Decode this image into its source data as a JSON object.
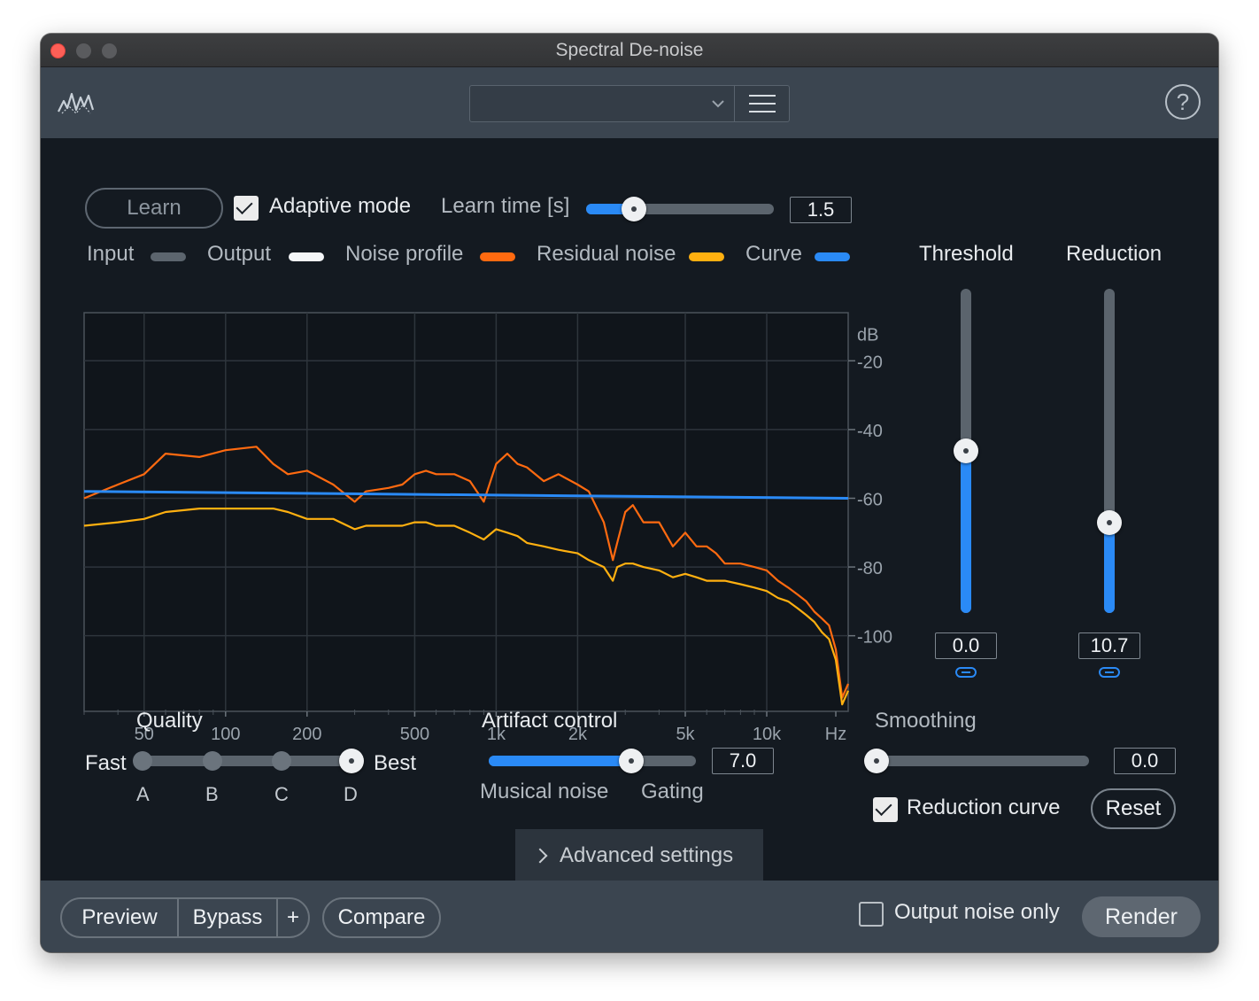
{
  "window": {
    "title": "Spectral De-noise"
  },
  "toolbar": {
    "preset_value": "",
    "help_label": "?"
  },
  "learn": {
    "button_label": "Learn",
    "adaptive_mode_label": "Adaptive mode",
    "adaptive_mode_checked": true,
    "learn_time_label": "Learn time [s]",
    "learn_time_value": "1.5",
    "learn_time_fraction": 0.24
  },
  "legend": {
    "items": [
      {
        "label": "Input",
        "color": "#5c656e"
      },
      {
        "label": "Output",
        "color": "#f4f6f8"
      },
      {
        "label": "Noise profile",
        "color": "#ff6a10"
      },
      {
        "label": "Residual noise",
        "color": "#ffb010"
      },
      {
        "label": "Curve",
        "color": "#2a8af6"
      }
    ]
  },
  "chart_data": {
    "type": "line",
    "x_scale": "log",
    "y_unit": "dB",
    "x_unit": "Hz",
    "x_ticks": [
      "50",
      "100",
      "200",
      "500",
      "1k",
      "2k",
      "5k",
      "10k",
      "Hz"
    ],
    "y_ticks": [
      "dB",
      "-20",
      "-40",
      "-60",
      "-80",
      "-100"
    ],
    "xlim": [
      30,
      20000
    ],
    "ylim": [
      -122,
      -6
    ],
    "series": [
      {
        "name": "Noise profile",
        "color": "#ff6a10",
        "x": [
          30,
          40,
          50,
          60,
          80,
          100,
          130,
          150,
          170,
          200,
          250,
          300,
          330,
          400,
          450,
          500,
          550,
          600,
          700,
          800,
          900,
          1000,
          1100,
          1200,
          1300,
          1500,
          1700,
          2000,
          2200,
          2500,
          2700,
          2800,
          3000,
          3200,
          3500,
          4000,
          4500,
          5000,
          5500,
          6000,
          6500,
          7000,
          8000,
          9000,
          10000,
          11000,
          12000,
          13000,
          14000,
          15000,
          16000,
          17000,
          18000,
          19000,
          20000
        ],
        "y": [
          -60,
          -56,
          -53,
          -47,
          -48,
          -46,
          -45,
          -50,
          -53,
          -52,
          -56,
          -61,
          -58,
          -57,
          -56,
          -53,
          -52,
          -53,
          -53,
          -55,
          -61,
          -50,
          -47,
          -50,
          -51,
          -55,
          -53,
          -56,
          -58,
          -67,
          -78,
          -73,
          -64,
          -62,
          -67,
          -67,
          -74,
          -70,
          -74,
          -74,
          -76,
          -79,
          -79,
          -80,
          -81,
          -84,
          -86,
          -88,
          -90,
          -93,
          -95,
          -97,
          -104,
          -118,
          -114
        ]
      },
      {
        "name": "Residual noise",
        "color": "#ffb010",
        "x": [
          30,
          40,
          50,
          60,
          80,
          100,
          130,
          150,
          170,
          200,
          250,
          300,
          330,
          400,
          450,
          500,
          550,
          600,
          700,
          800,
          900,
          1000,
          1100,
          1200,
          1300,
          1500,
          1700,
          2000,
          2200,
          2500,
          2700,
          2800,
          3000,
          3200,
          3500,
          4000,
          4500,
          5000,
          5500,
          6000,
          6500,
          7000,
          8000,
          9000,
          10000,
          11000,
          12000,
          13000,
          14000,
          15000,
          16000,
          17000,
          18000,
          19000,
          20000
        ],
        "y": [
          -68,
          -67,
          -66,
          -64,
          -63,
          -63,
          -63,
          -63,
          -64,
          -66,
          -66,
          -69,
          -68,
          -68,
          -68,
          -67,
          -67,
          -68,
          -68,
          -70,
          -72,
          -69,
          -70,
          -71,
          -73,
          -74,
          -75,
          -76,
          -78,
          -80,
          -84,
          -80,
          -79,
          -79,
          -80,
          -81,
          -83,
          -82,
          -83,
          -84,
          -84,
          -84,
          -85,
          -86,
          -87,
          -89,
          -90,
          -92,
          -94,
          -96,
          -99,
          -101,
          -107,
          -120,
          -116
        ]
      },
      {
        "name": "Curve",
        "color": "#2a8af6",
        "x": [
          30,
          20000
        ],
        "y": [
          -58,
          -60
        ]
      }
    ]
  },
  "threshold": {
    "label": "Threshold",
    "value": "0.0",
    "fraction": 0.5
  },
  "reduction": {
    "label": "Reduction",
    "value": "10.7",
    "fraction": 0.27
  },
  "quality": {
    "label": "Quality",
    "fast_label": "Fast",
    "best_label": "Best",
    "options": [
      "A",
      "B",
      "C",
      "D"
    ],
    "selected": "D"
  },
  "artifact": {
    "label": "Artifact control",
    "value": "7.0",
    "fraction": 0.7,
    "left_label": "Musical noise",
    "right_label": "Gating"
  },
  "smoothing": {
    "label": "Smoothing",
    "value": "0.0",
    "fraction": 0.0
  },
  "reduction_curve": {
    "label": "Reduction curve",
    "checked": true,
    "reset_label": "Reset"
  },
  "advanced": {
    "label": "Advanced settings"
  },
  "footer": {
    "preview_label": "Preview",
    "bypass_label": "Bypass",
    "plus_label": "+",
    "compare_label": "Compare",
    "output_noise_only_label": "Output noise only",
    "output_noise_only_checked": false,
    "render_label": "Render"
  }
}
